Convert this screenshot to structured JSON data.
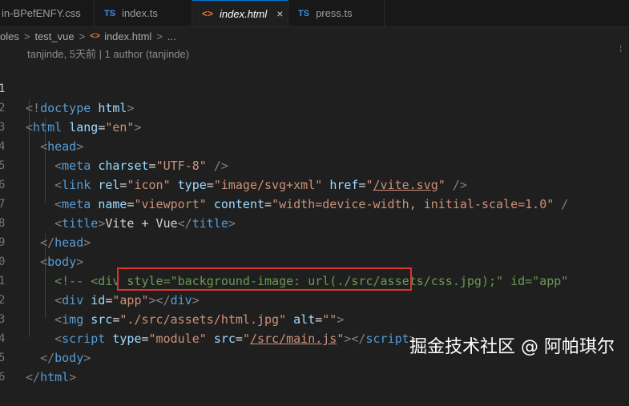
{
  "tabs": [
    {
      "label": "in-BPefENFY.css",
      "icon": "css-file-icon",
      "active": false
    },
    {
      "label": "index.ts",
      "icon": "ts-file-icon",
      "icon_text": "TS",
      "active": false
    },
    {
      "label": "index.html",
      "icon": "html-file-icon",
      "icon_text": "<>",
      "active": true,
      "close": "×"
    },
    {
      "label": "press.ts",
      "icon": "ts-file-icon",
      "icon_text": "TS",
      "active": false
    }
  ],
  "breadcrumb": {
    "items": [
      "oles",
      "test_vue",
      "index.html",
      "..."
    ],
    "separator": ">"
  },
  "blame": "tanjinde, 5天前 | 1 author (tanjinde)",
  "line_numbers": [
    "1",
    "2",
    "3",
    "4",
    "5",
    "6",
    "7",
    "8",
    "9",
    "10",
    "11",
    "12",
    "13",
    "14",
    "15",
    "16"
  ],
  "line_numbers_visible": [
    "1",
    "2",
    "3",
    "4",
    "5",
    "6",
    "7",
    "8",
    "9",
    "0",
    "1",
    "2",
    "3",
    "4",
    "5",
    "6"
  ],
  "code": {
    "doctype_open": "<!",
    "doctype_kw": "doctype",
    "doctype_val": "html",
    "doctype_close": ">",
    "html_lang_attr": "lang",
    "html_lang_val": "\"en\"",
    "meta_charset_attr": "charset",
    "meta_charset_val": "\"UTF-8\"",
    "link_rel_attr": "rel",
    "link_rel_val": "\"icon\"",
    "link_type_attr": "type",
    "link_type_val": "\"image/svg+xml\"",
    "link_href_attr": "href",
    "link_href_q1": "\"",
    "link_href_val": "/vite.svg",
    "link_href_q2": "\"",
    "meta_name_attr": "name",
    "meta_name_val": "\"viewport\"",
    "meta_content_attr": "content",
    "meta_content_val": "\"width=device-width, initial-scale=1.0\"",
    "meta_tail": " /",
    "title_text": "Vite + Vue",
    "comment": "<!-- <div style=\"background-image: url(./src/assets/css.jpg);\" id=\"app\"",
    "div_id_attr": "id",
    "div_id_val": "\"app\"",
    "img_src_attr": "src",
    "img_src_val": "\"./src/assets/html.jpg\"",
    "img_alt_attr": "alt",
    "img_alt_val": "\"\"",
    "script_type_attr": "type",
    "script_type_val": "\"module\"",
    "script_src_attr": "src",
    "script_src_q1": "\"",
    "script_src_val": "/src/main.js",
    "script_src_q2": "\""
  },
  "tags": {
    "html": "html",
    "head": "head",
    "meta": "meta",
    "link": "link",
    "title": "title",
    "body": "body",
    "div": "div",
    "img": "img",
    "script": "script"
  },
  "watermark": "掘金技术社区 @ 阿帕琪尔",
  "colors": {
    "highlight_box": "#e0322c",
    "tag": "#569cd6",
    "attr": "#9cdcfe",
    "string": "#ce9178",
    "comment": "#6a9955"
  }
}
